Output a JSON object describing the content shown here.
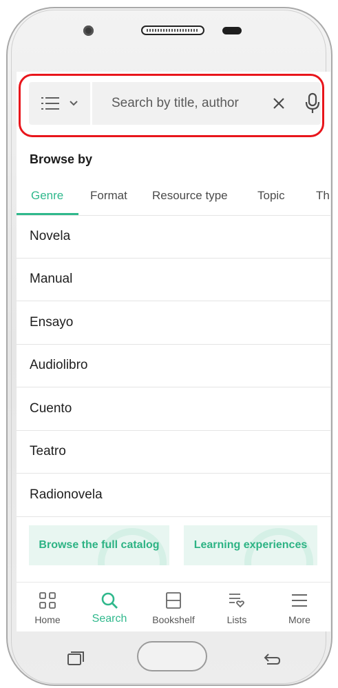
{
  "search": {
    "placeholder": "Search by title, author"
  },
  "browse": {
    "title": "Browse by",
    "tabs": [
      {
        "label": "Genre",
        "active": true
      },
      {
        "label": "Format",
        "active": false
      },
      {
        "label": "Resource type",
        "active": false
      },
      {
        "label": "Topic",
        "active": false
      },
      {
        "label": "Th",
        "active": false
      }
    ],
    "genres": [
      "Novela",
      "Manual",
      "Ensayo",
      "Audiolibro",
      "Cuento",
      "Teatro",
      "Radionovela"
    ]
  },
  "cards": {
    "catalog": "Browse the full catalog",
    "learning": "Learning experiences"
  },
  "nav": {
    "items": [
      {
        "label": "Home",
        "icon": "grid-icon",
        "active": false
      },
      {
        "label": "Search",
        "icon": "search-icon",
        "active": true
      },
      {
        "label": "Bookshelf",
        "icon": "bookshelf-icon",
        "active": false
      },
      {
        "label": "Lists",
        "icon": "list-heart-icon",
        "active": false
      },
      {
        "label": "More",
        "icon": "menu-icon",
        "active": false
      }
    ]
  },
  "colors": {
    "accent": "#2fb88c",
    "highlight": "#e8151b",
    "search_bg": "#f1f1f1",
    "card_bg": "#e8f6f1"
  }
}
